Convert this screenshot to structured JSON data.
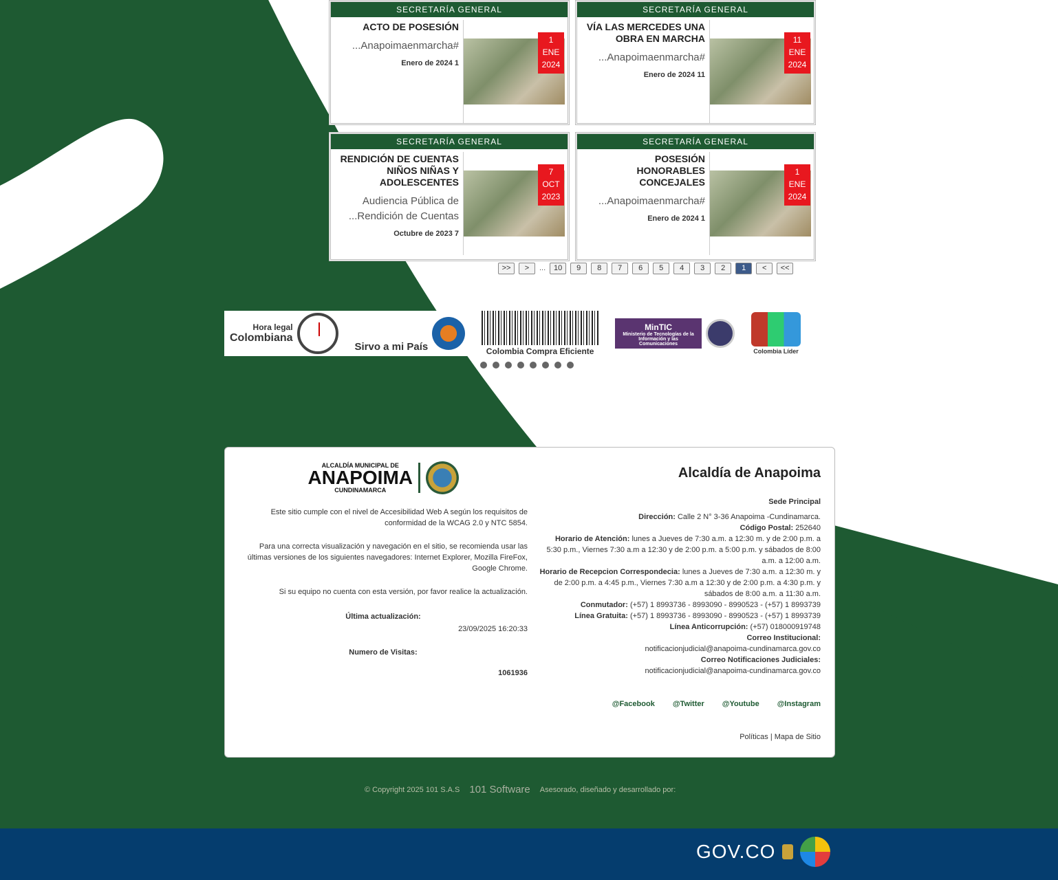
{
  "colors": {
    "green": "#1e5a32",
    "badge_red": "#e8181f",
    "gov_blue": "#053d6e"
  },
  "cards": [
    {
      "category": "SECRETARÍA GENERAL",
      "title": "ACTO DE POSESIÓN",
      "excerpt": "#Anapoimaenmarcha...",
      "date": "1 Enero de 2024",
      "badge": {
        "day": "1",
        "month": "ENE",
        "year": "2024"
      }
    },
    {
      "category": "SECRETARÍA GENERAL",
      "title": "VÍA LAS MERCEDES UNA OBRA EN MARCHA",
      "excerpt": "#Anapoimaenmarcha...",
      "date": "11 Enero de 2024",
      "badge": {
        "day": "11",
        "month": "ENE",
        "year": "2024"
      }
    },
    {
      "category": "SECRETARÍA GENERAL",
      "title": "RENDICIÓN DE CUENTAS NIÑOS NIÑAS Y ADOLESCENTES",
      "excerpt": "Audiencia Pública de Rendición de Cuentas...",
      "date": "7 Octubre de 2023",
      "badge": {
        "day": "7",
        "month": "OCT",
        "year": "2023"
      }
    },
    {
      "category": "SECRETARÍA GENERAL",
      "title": "POSESIÓN HONORABLES CONCEJALES",
      "excerpt": "#Anapoimaenmarcha...",
      "date": "1 Enero de 2024",
      "badge": {
        "day": "1",
        "month": "ENE",
        "year": "2024"
      }
    }
  ],
  "pagination": {
    "first": "<<",
    "prev": "<",
    "pages": [
      "1",
      "2",
      "3",
      "4",
      "5",
      "6",
      "7",
      "8",
      "9",
      "10"
    ],
    "ellipsis": "...",
    "next": ">",
    "last": ">>",
    "current": "1"
  },
  "logos": {
    "hora_legal_line1": "Hora legal",
    "hora_legal_line2": "Colombiana",
    "sirvo": "Sirvo a mi País",
    "compra": "Colombia Compra Eficiente",
    "mintic": "MinTIC",
    "mintic_sub": "Ministerio de Tecnologías de la Información y las Comunicaciones",
    "kids": "Colombia Líder",
    "dots_count": 8
  },
  "footer": {
    "title": "Alcaldía de Anapoima",
    "sede": "Sede Principal",
    "direccion_label": "Dirección:",
    "direccion": "Calle 2 N° 3-36 Anapoima -Cundinamarca.",
    "postal_label": "Código Postal:",
    "postal": "252640",
    "horario_label": "Horario de Atención:",
    "horario": "lunes a Jueves de 7:30 a.m. a 12:30 m. y de 2:00 p.m. a 5:30 p.m., Viernes 7:30 a.m a 12:30 y de 2:00 p.m. a 5:00 p.m. y sábados de 8:00 a.m. a 12:00 a.m.",
    "correspondencia_label": "Horario de Recepcion Correspondecia:",
    "correspondencia": "lunes a Jueves de 7:30 a.m. a 12:30 m. y de 2:00 p.m. a 4:45 p.m., Viernes 7:30 a.m a 12:30 y de 2:00 p.m. a 4:30 p.m. y sábados de 8:00 a.m. a 11:30 a.m.",
    "conmutador_label": "Conmutador:",
    "conmutador": "(+57) 1 8993736 - 8993090 - 8990523 - (+57) 1 8993739",
    "gratuita_label": "Línea Gratuita:",
    "gratuita": "(+57) 1 8993736 - 8993090 - 8990523 - (+57) 1 8993739",
    "anticorrupcion_label": "Línea Anticorrupción:",
    "anticorrupcion": "(+57) 018000919748",
    "correo_label": "Correo Institucional:",
    "correo": "notificacionjudicial@anapoima-cundinamarca.gov.co",
    "notif_label": "Correo Notificaciones Judiciales:",
    "notif": "notificacionjudicial@anapoima-cundinamarca.gov.co",
    "social": [
      "@Facebook",
      "@Twitter",
      "@Youtube",
      "@Instagram"
    ],
    "policy": "Políticas | Mapa de Sitio",
    "brand_top": "ALCALDÍA MUNICIPAL DE",
    "brand_name": "ANAPOIMA",
    "brand_bottom": "CUNDINAMARCA",
    "accesibilidad": "Este sitio cumple con el nivel de Accesibilidad Web A según los requisitos de conformidad de la WCAG 2.0 y NTC 5854.",
    "navegadores": "Para una correcta visualización y navegación en el sitio, se recomienda usar las últimas versiones de los siguientes navegadores: Internet Explorer, Mozilla FireFox, Google Chrome.",
    "actualice": "Si su equipo no cuenta con esta versión, por favor realice la actualización.",
    "ultima_label": "Última actualización:",
    "ultima": "23/09/2025 16:20:33",
    "visitas_label": "Numero de Visitas:",
    "visitas": "1061936"
  },
  "credits": {
    "text": "Asesorado, diseñado y desarrollado por:",
    "brand": "101 Software",
    "copyright": "© Copyright 2025 101 S.A.S"
  },
  "gov": {
    "text": "GOV.CO",
    "co": "CO"
  }
}
